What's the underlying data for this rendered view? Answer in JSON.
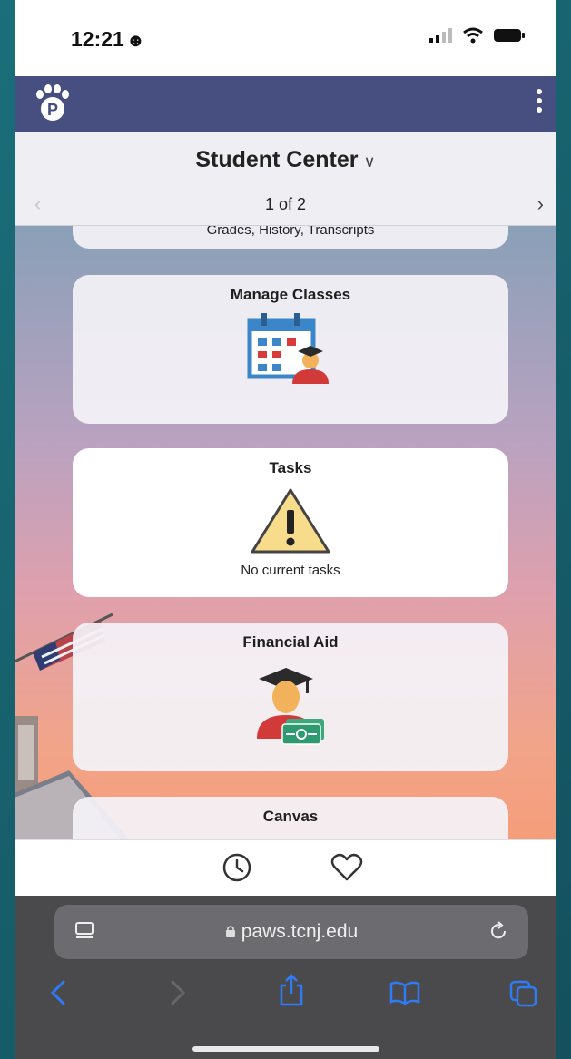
{
  "status_bar": {
    "time": "12:21"
  },
  "header": {
    "logo_letter": "P"
  },
  "page": {
    "title": "Student Center",
    "pager": "1 of 2"
  },
  "tiles": [
    {
      "title": "",
      "subtitle": "Grades, History, Transcripts"
    },
    {
      "title": "Manage Classes",
      "icon": "calendar-student-icon"
    },
    {
      "title": "Tasks",
      "icon": "warning-icon",
      "subtitle": "No current tasks"
    },
    {
      "title": "Financial Aid",
      "icon": "graduate-money-icon"
    },
    {
      "title": "Canvas",
      "icon": "canvas-icon"
    }
  ],
  "toolbar": {
    "icons": [
      "clock-icon",
      "heart-icon"
    ]
  },
  "browser": {
    "url": "paws.tcnj.edu",
    "icons": [
      "reader-icon",
      "reload-icon",
      "back-icon",
      "forward-icon",
      "share-icon",
      "bookmarks-icon",
      "tabs-icon"
    ]
  },
  "colors": {
    "header": "#464f80",
    "browser_chrome": "#4a4a4d",
    "accent_blue": "#2f7bf6"
  }
}
